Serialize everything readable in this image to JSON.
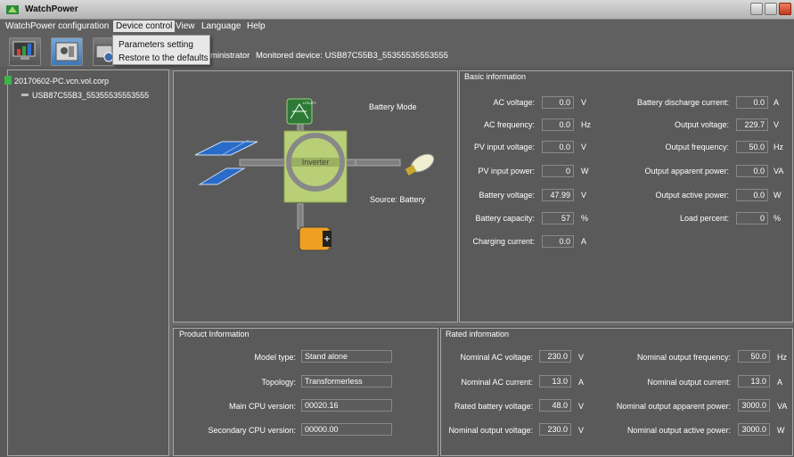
{
  "window": {
    "title": "WatchPower"
  },
  "menu": {
    "items": [
      "WatchPower configuration",
      "Device control",
      "View",
      "Language",
      "Help"
    ]
  },
  "dropdown": {
    "items": [
      "Parameters setting",
      "Restore to the defaults"
    ]
  },
  "toolbar": {
    "user_text": "ministrator",
    "monitored_text": "Monitored device:  USB87C55B3_55355535553555"
  },
  "tree": {
    "host": "20170602-PC.vcn.vol.corp",
    "device": "USB87C55B3_55355535553555"
  },
  "diagram": {
    "mode": "Battery Mode",
    "source": "Source:  Battery",
    "inverter_label": "Inverter",
    "utility_label": "UTILITY"
  },
  "basic": {
    "title": "Basic information",
    "left": [
      {
        "label": "AC voltage:",
        "value": "0.0",
        "unit": "V"
      },
      {
        "label": "AC frequency:",
        "value": "0.0",
        "unit": "Hz"
      },
      {
        "label": "PV input voltage:",
        "value": "0.0",
        "unit": "V"
      },
      {
        "label": "PV input power:",
        "value": "0",
        "unit": "W"
      },
      {
        "label": "Battery voltage:",
        "value": "47.99",
        "unit": "V"
      },
      {
        "label": "Battery capacity:",
        "value": "57",
        "unit": "%"
      },
      {
        "label": "Charging current:",
        "value": "0.0",
        "unit": "A"
      }
    ],
    "right": [
      {
        "label": "Battery discharge current:",
        "value": "0.0",
        "unit": "A"
      },
      {
        "label": "Output voltage:",
        "value": "229.7",
        "unit": "V"
      },
      {
        "label": "Output frequency:",
        "value": "50.0",
        "unit": "Hz"
      },
      {
        "label": "Output apparent power:",
        "value": "0.0",
        "unit": "VA"
      },
      {
        "label": "Output active power:",
        "value": "0.0",
        "unit": "W"
      },
      {
        "label": "Load percent:",
        "value": "0",
        "unit": "%"
      }
    ]
  },
  "product": {
    "title": "Product Information",
    "rows": [
      {
        "label": "Model type:",
        "value": "Stand alone"
      },
      {
        "label": "Topology:",
        "value": "Transformerless"
      },
      {
        "label": "Main CPU version:",
        "value": "00020.16"
      },
      {
        "label": "Secondary CPU version:",
        "value": "00000.00"
      }
    ]
  },
  "rated": {
    "title": "Rated information",
    "left": [
      {
        "label": "Nominal AC voltage:",
        "value": "230.0",
        "unit": "V"
      },
      {
        "label": "Nominal AC current:",
        "value": "13.0",
        "unit": "A"
      },
      {
        "label": "Rated battery voltage:",
        "value": "48.0",
        "unit": "V"
      },
      {
        "label": "Nominal output voltage:",
        "value": "230.0",
        "unit": "V"
      }
    ],
    "right": [
      {
        "label": "Nominal output frequency:",
        "value": "50.0",
        "unit": "Hz"
      },
      {
        "label": "Nominal output current:",
        "value": "13.0",
        "unit": "A"
      },
      {
        "label": "Nominal output apparent power:",
        "value": "3000.0",
        "unit": "VA"
      },
      {
        "label": "Nominal output active power:",
        "value": "3000.0",
        "unit": "W"
      }
    ]
  },
  "colors": {
    "accent": "#3c8cd8",
    "panel_bg": "#5a5a5a",
    "inverter_green": "#b8cf78"
  }
}
